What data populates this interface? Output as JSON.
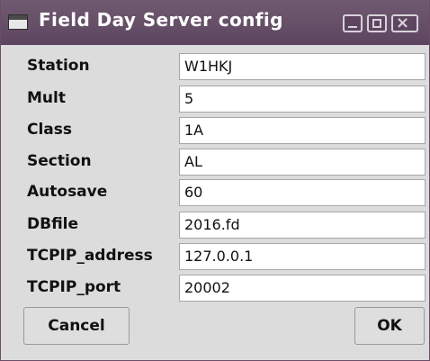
{
  "window": {
    "title": "Field Day Server config",
    "icons": {
      "app": "window-app-icon",
      "minimize": "minimize-icon",
      "maximize": "maximize-icon",
      "close": "close-icon"
    },
    "close_glyph": "×",
    "colors": {
      "titlebar": "#5d4560",
      "background": "#dcdcdc",
      "field": "#ffffff"
    }
  },
  "fields": [
    {
      "label": "Station",
      "value": "W1HKJ"
    },
    {
      "label": "Mult",
      "value": "5"
    },
    {
      "label": "Class",
      "value": "1A"
    },
    {
      "label": "Section",
      "value": "AL"
    },
    {
      "label": "Autosave",
      "value": "60"
    },
    {
      "label": "DBfile",
      "value": "2016.fd"
    },
    {
      "label": "TCPIP_address",
      "value": "127.0.0.1"
    },
    {
      "label": "TCPIP_port",
      "value": "20002"
    }
  ],
  "buttons": {
    "cancel": "Cancel",
    "ok": "OK"
  }
}
